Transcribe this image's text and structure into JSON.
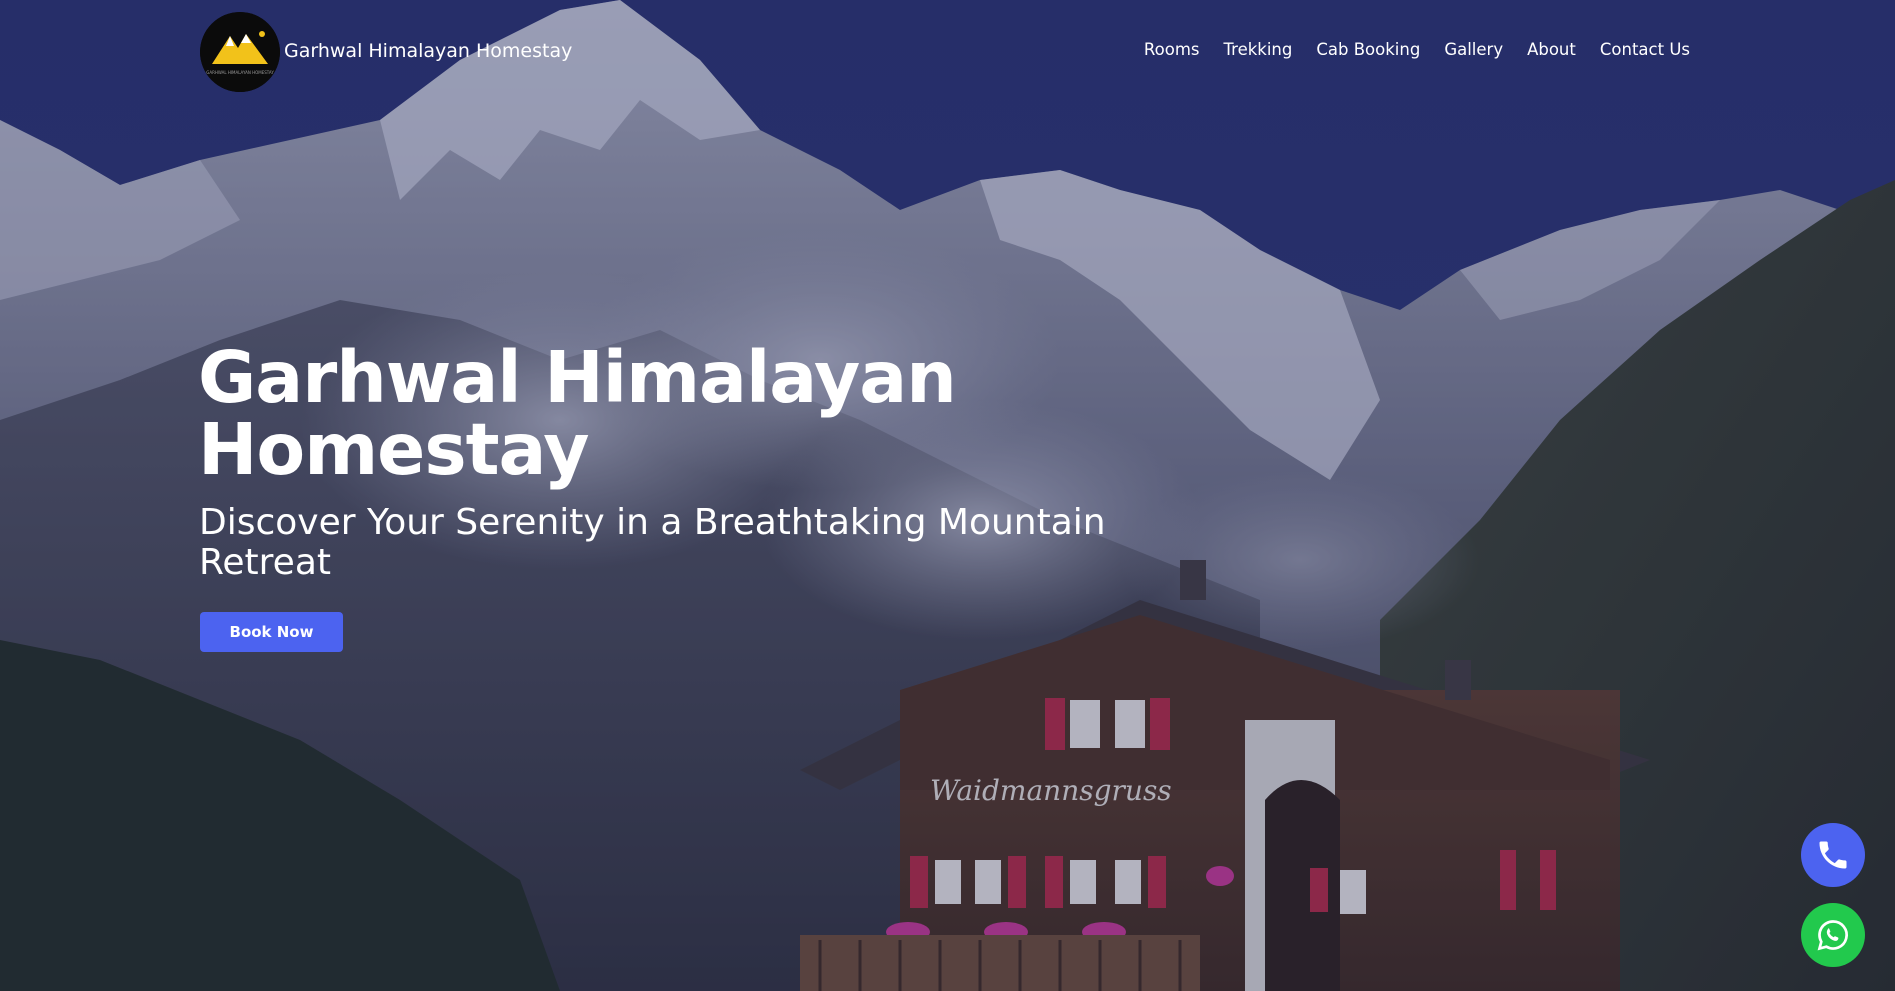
{
  "colors": {
    "overlay": "#262f68",
    "accent": "#4c63f0",
    "whatsapp": "#22c94d",
    "text": "#ffffff"
  },
  "header": {
    "logo_icon": "mountain-sun-logo-icon",
    "logo_text": "GARHWAL HIMALAYAN HOMESTAY",
    "brand": "Garhwal Himalayan Homestay",
    "nav": [
      {
        "label": "Rooms"
      },
      {
        "label": "Trekking"
      },
      {
        "label": "Cab Booking"
      },
      {
        "label": "Gallery"
      },
      {
        "label": "About"
      },
      {
        "label": "Contact Us"
      }
    ]
  },
  "hero": {
    "title_line1": "Garhwal Himalayan",
    "title_line2": "Homestay",
    "subtitle_line1": "Discover Your Serenity in a Breathtaking Mountain",
    "subtitle_line2": "Retreat",
    "cta": "Book Now",
    "chalet_sign": "Waidmannsgruss"
  },
  "floating": {
    "phone_icon": "phone-icon",
    "whatsapp_icon": "whatsapp-icon"
  }
}
